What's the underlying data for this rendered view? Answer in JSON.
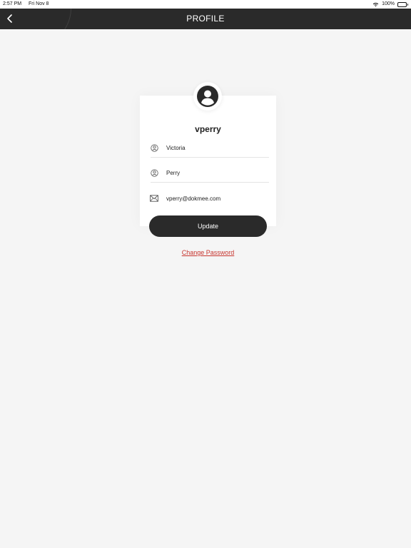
{
  "status_bar": {
    "time": "2:57 PM",
    "date": "Fri Nov 8",
    "battery": "100%"
  },
  "nav": {
    "title": "PROFILE",
    "back_icon": "chevron-left-icon"
  },
  "profile": {
    "avatar_icon": "user-circle-icon",
    "username": "vperry",
    "fields": [
      {
        "icon": "user-outline-icon",
        "value": "Victoria"
      },
      {
        "icon": "user-outline-icon",
        "value": "Perry"
      },
      {
        "icon": "mail-icon",
        "value": "vperry@dokmee.com"
      }
    ]
  },
  "actions": {
    "update_label": "Update",
    "change_password_label": "Change Password"
  },
  "colors": {
    "nav_background": "#2a2a2a",
    "page_background": "#f5f5f5",
    "link_red": "#c7352f"
  }
}
